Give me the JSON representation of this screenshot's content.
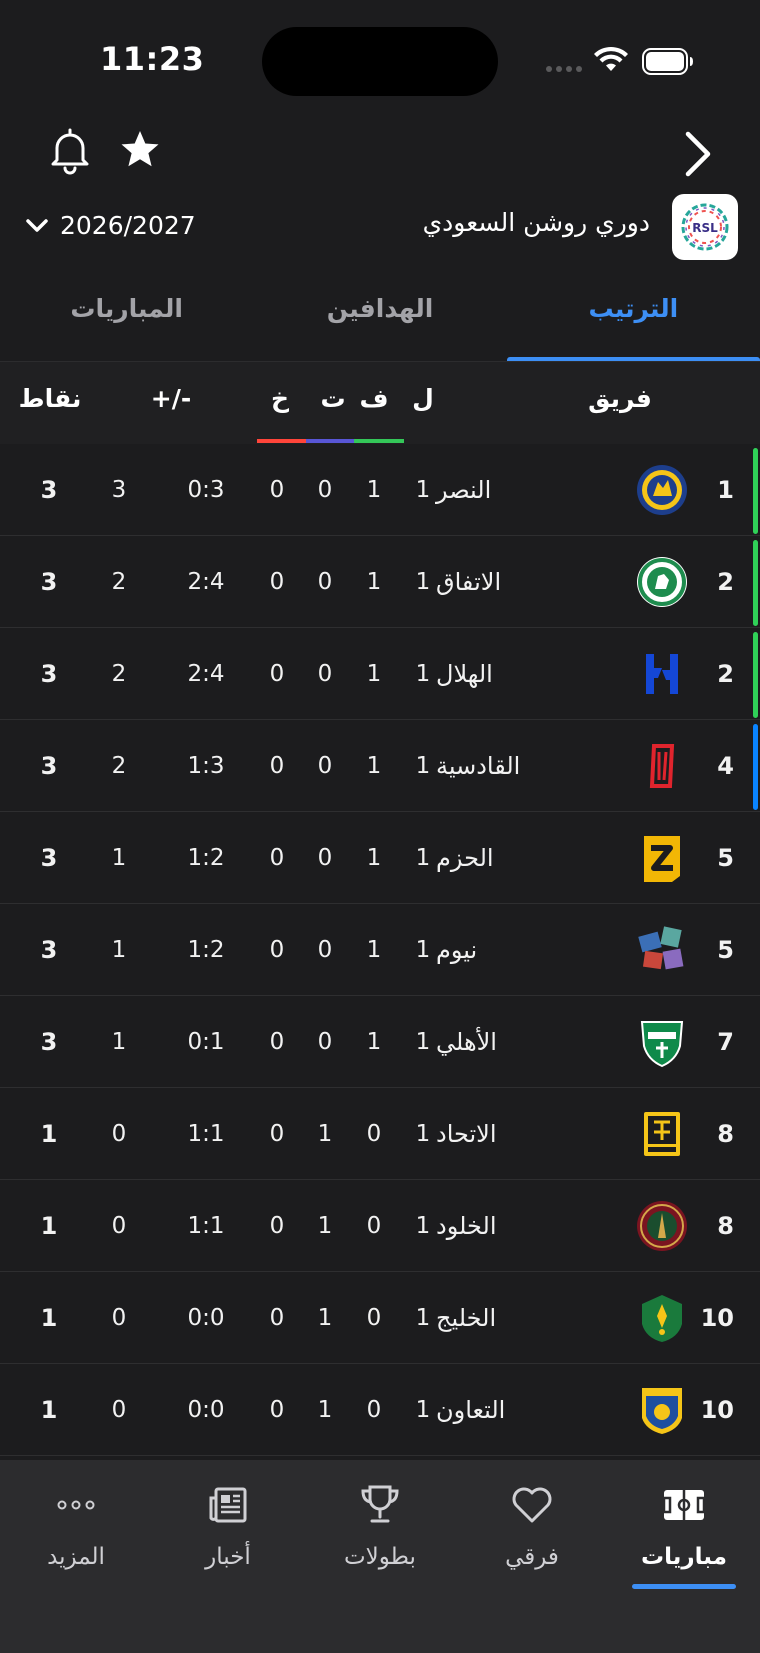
{
  "status_bar": {
    "time": "11:23"
  },
  "header": {
    "league_name": "دوري روشن السعودي",
    "league_logo_text": "RSL",
    "season": "2026/2027"
  },
  "tabs": [
    {
      "label": "الترتيب",
      "active": true
    },
    {
      "label": "الهدافين",
      "active": false
    },
    {
      "label": "المباريات",
      "active": false
    }
  ],
  "table": {
    "columns": {
      "team": "فريق",
      "played": "ل",
      "won": "ف",
      "drawn": "ت",
      "lost": "خ",
      "diff": "+/-",
      "points": "نقاط"
    },
    "colors": {
      "won": "#34c759",
      "drawn": "#5856d6",
      "lost": "#ff453a",
      "champions": "#30d158",
      "playoff": "#0a84ff"
    },
    "rows": [
      {
        "rank": "1",
        "team": "النصر",
        "logo": "al-nassr-logo",
        "played": "1",
        "won": "1",
        "drawn": "0",
        "lost": "0",
        "goals": "0:3",
        "diff": "3",
        "points": "3",
        "zone": "champions"
      },
      {
        "rank": "2",
        "team": "الاتفاق",
        "logo": "al-ettifaq-logo",
        "played": "1",
        "won": "1",
        "drawn": "0",
        "lost": "0",
        "goals": "2:4",
        "diff": "2",
        "points": "3",
        "zone": "champions"
      },
      {
        "rank": "2",
        "team": "الهلال",
        "logo": "al-hilal-logo",
        "played": "1",
        "won": "1",
        "drawn": "0",
        "lost": "0",
        "goals": "2:4",
        "diff": "2",
        "points": "3",
        "zone": "champions"
      },
      {
        "rank": "4",
        "team": "القادسية",
        "logo": "al-qadsiah-logo",
        "played": "1",
        "won": "1",
        "drawn": "0",
        "lost": "0",
        "goals": "1:3",
        "diff": "2",
        "points": "3",
        "zone": "playoff"
      },
      {
        "rank": "5",
        "team": "الحزم",
        "logo": "al-hazem-logo",
        "played": "1",
        "won": "1",
        "drawn": "0",
        "lost": "0",
        "goals": "1:2",
        "diff": "1",
        "points": "3",
        "zone": "none"
      },
      {
        "rank": "5",
        "team": "نيوم",
        "logo": "neom-logo",
        "played": "1",
        "won": "1",
        "drawn": "0",
        "lost": "0",
        "goals": "1:2",
        "diff": "1",
        "points": "3",
        "zone": "none"
      },
      {
        "rank": "7",
        "team": "الأهلي",
        "logo": "al-ahli-logo",
        "played": "1",
        "won": "1",
        "drawn": "0",
        "lost": "0",
        "goals": "0:1",
        "diff": "1",
        "points": "3",
        "zone": "none"
      },
      {
        "rank": "8",
        "team": "الاتحاد",
        "logo": "al-ittihad-logo",
        "played": "1",
        "won": "0",
        "drawn": "1",
        "lost": "0",
        "goals": "1:1",
        "diff": "0",
        "points": "1",
        "zone": "none"
      },
      {
        "rank": "8",
        "team": "الخلود",
        "logo": "al-kholood-logo",
        "played": "1",
        "won": "0",
        "drawn": "1",
        "lost": "0",
        "goals": "1:1",
        "diff": "0",
        "points": "1",
        "zone": "none"
      },
      {
        "rank": "10",
        "team": "الخليج",
        "logo": "al-khaleej-logo",
        "played": "1",
        "won": "0",
        "drawn": "1",
        "lost": "0",
        "goals": "0:0",
        "diff": "0",
        "points": "1",
        "zone": "none"
      },
      {
        "rank": "10",
        "team": "التعاون",
        "logo": "al-taawoun-logo",
        "played": "1",
        "won": "0",
        "drawn": "1",
        "lost": "0",
        "goals": "0:0",
        "diff": "0",
        "points": "1",
        "zone": "none"
      }
    ]
  },
  "bottom_nav": [
    {
      "label": "مباريات",
      "icon": "pitch-icon",
      "active": true
    },
    {
      "label": "فرقي",
      "icon": "heart-icon",
      "active": false
    },
    {
      "label": "بطولات",
      "icon": "trophy-icon",
      "active": false
    },
    {
      "label": "أخبار",
      "icon": "news-icon",
      "active": false
    },
    {
      "label": "المزيد",
      "icon": "more-icon",
      "active": false
    }
  ]
}
